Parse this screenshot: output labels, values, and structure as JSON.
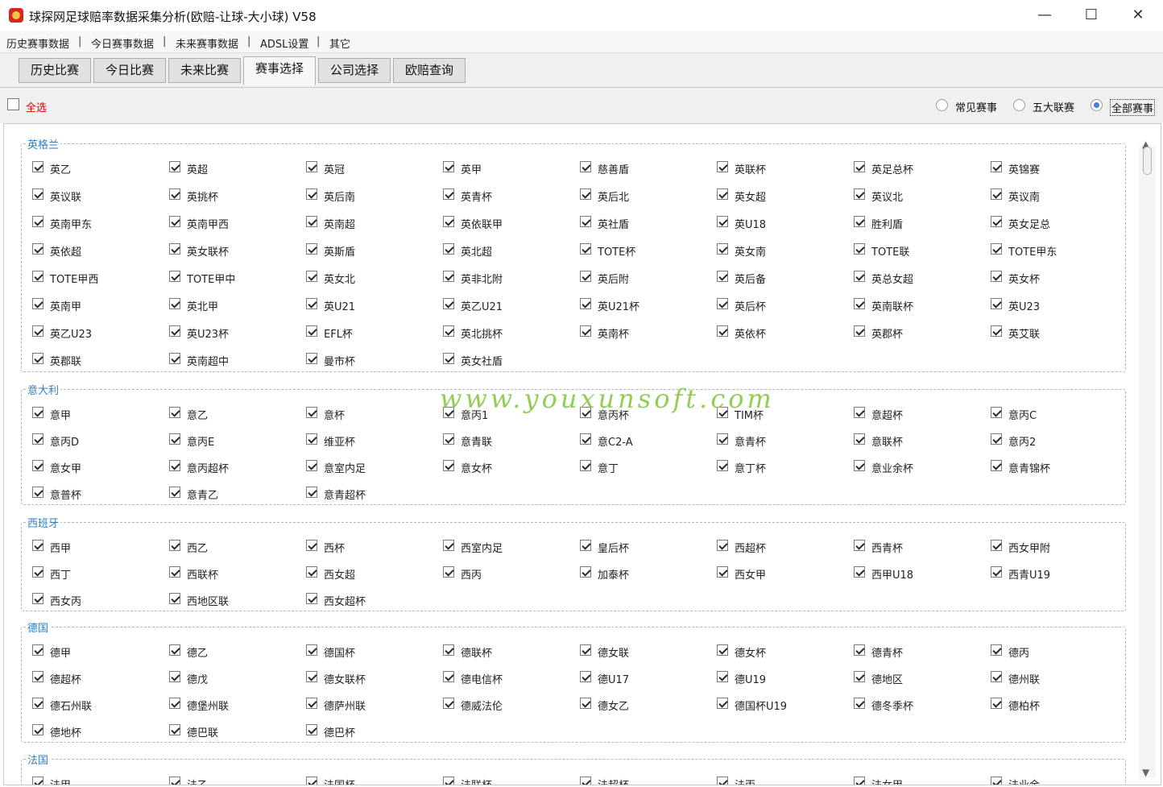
{
  "window": {
    "title": "球探网足球赔率数据采集分析(欧赔-让球-大小球) V58",
    "minimize": "—",
    "maximize": "☐",
    "close": "✕"
  },
  "menu": [
    {
      "label": "历史赛事数据"
    },
    {
      "label": "今日赛事数据"
    },
    {
      "label": "未来赛事数据"
    },
    {
      "label": "ADSL设置"
    },
    {
      "label": "其它"
    }
  ],
  "menu_separator": "|",
  "tabs": [
    {
      "label": "历史比赛"
    },
    {
      "label": "今日比赛"
    },
    {
      "label": "未来比赛"
    },
    {
      "label": "赛事选择",
      "active": true
    },
    {
      "label": "公司选择"
    },
    {
      "label": "欧赔查询"
    }
  ],
  "select_all": "全选",
  "filters": [
    {
      "label": "常见赛事",
      "selected": false
    },
    {
      "label": "五大联赛",
      "selected": false
    },
    {
      "label": "全部赛事",
      "selected": true
    }
  ],
  "colors": {
    "accent": "#4b7fd1",
    "select_all": "#e00000",
    "group_title": "#2f7fc0",
    "watermark": "#7ec53a"
  },
  "watermark": "www.youxunsoft.com",
  "groups": [
    {
      "title": "英格兰",
      "items": [
        "英乙",
        "英超",
        "英冠",
        "英甲",
        "慈善盾",
        "英联杯",
        "英足总杯",
        "英锦赛",
        "英议联",
        "英挑杯",
        "英后南",
        "英青杯",
        "英后北",
        "英女超",
        "英议北",
        "英议南",
        "英南甲东",
        "英南甲西",
        "英南超",
        "英依联甲",
        "英社盾",
        "英U18",
        "胜利盾",
        "英女足总",
        "英依超",
        "英女联杯",
        "英斯盾",
        "英北超",
        "TOTE杯",
        "英女南",
        "TOTE联",
        "TOTE甲东",
        "TOTE甲西",
        "TOTE甲中",
        "英女北",
        "英非北附",
        "英后附",
        "英后备",
        "英总女超",
        "英女杯",
        "英南甲",
        "英北甲",
        "英U21",
        "英乙U21",
        "英U21杯",
        "英后杯",
        "英南联杯",
        "英U23",
        "英乙U23",
        "英U23杯",
        "EFL杯",
        "英北挑杯",
        "英南杯",
        "英依杯",
        "英郡杯",
        "英艾联",
        "英郡联",
        "英南超中",
        "曼市杯",
        "英女社盾"
      ]
    },
    {
      "title": "意大利",
      "items": [
        "意甲",
        "意乙",
        "意杯",
        "意丙1",
        "意丙杯",
        "TIM杯",
        "意超杯",
        "意丙C",
        "意丙D",
        "意丙E",
        "维亚杯",
        "意青联",
        "意C2-A",
        "意青杯",
        "意联杯",
        "意丙2",
        "意女甲",
        "意丙超杯",
        "意室内足",
        "意女杯",
        "意丁",
        "意丁杯",
        "意业余杯",
        "意青锦杯",
        "意普杯",
        "意青乙",
        "意青超杯"
      ]
    },
    {
      "title": "西班牙",
      "items": [
        "西甲",
        "西乙",
        "西杯",
        "西室内足",
        "皇后杯",
        "西超杯",
        "西青杯",
        "西女甲附",
        "西丁",
        "西联杯",
        "西女超",
        "西丙",
        "加泰杯",
        "西女甲",
        "西甲U18",
        "西青U19",
        "西女丙",
        "西地区联",
        "西女超杯"
      ]
    },
    {
      "title": "德国",
      "items": [
        "德甲",
        "德乙",
        "德国杯",
        "德联杯",
        "德女联",
        "德女杯",
        "德青杯",
        "德丙",
        "德超杯",
        "德戊",
        "德女联杯",
        "德电信杯",
        "德U17",
        "德U19",
        "德地区",
        "德州联",
        "德石州联",
        "德堡州联",
        "德萨州联",
        "德威法伦",
        "德女乙",
        "德国杯U19",
        "德冬季杯",
        "德柏杯",
        "德地杯",
        "德巴联",
        "德巴杯"
      ]
    },
    {
      "title": "法国",
      "items": [
        "法甲",
        "法乙",
        "法国杯",
        "法联杯",
        "法超杯",
        "法丙",
        "法女甲",
        "法业余"
      ]
    }
  ]
}
